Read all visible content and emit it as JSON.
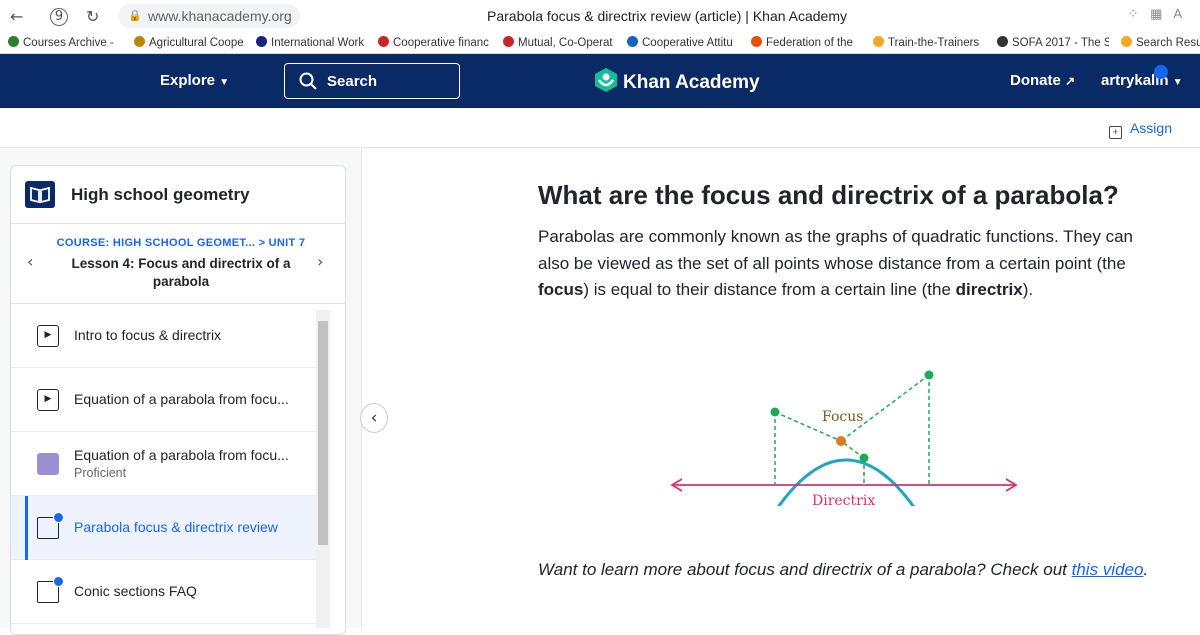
{
  "browser": {
    "url": "www.khanacademy.org",
    "tab_title": "Parabola focus & directrix review (article) | Khan Academy",
    "bookmarks": [
      {
        "label": "Courses Archive - ",
        "color": "#2e7d32"
      },
      {
        "label": "Agricultural Coope",
        "color": "#b8860b"
      },
      {
        "label": "International Work",
        "color": "#1a237e"
      },
      {
        "label": "Cooperative financ",
        "color": "#c62828"
      },
      {
        "label": "Mutual, Co-Operat",
        "color": "#c62828"
      },
      {
        "label": "Cooperative Attitu",
        "color": "#1565c0"
      },
      {
        "label": "Federation of the",
        "color": "#e65100"
      },
      {
        "label": "Train-the-Trainers",
        "color": "#f9a825"
      },
      {
        "label": "SOFA 2017 - The S",
        "color": "#333333"
      },
      {
        "label": "Search Resu",
        "color": "#f9a825"
      }
    ]
  },
  "nav": {
    "explore": "Explore",
    "search": "Search",
    "logo": "Khan Academy",
    "donate": "Donate",
    "user": "artrykalin"
  },
  "assign": "Assign",
  "sidebar": {
    "course": "High school geometry",
    "breadcrumb": "COURSE: HIGH SCHOOL GEOMET... > UNIT 7",
    "lesson": "Lesson 4: Focus and directrix of a parabola",
    "items": [
      {
        "label": "Intro to focus & directrix",
        "sub": ""
      },
      {
        "label": "Equation of a parabola from focu...",
        "sub": ""
      },
      {
        "label": "Equation of a parabola from focu...",
        "sub": "Proficient"
      },
      {
        "label": "Parabola focus & directrix review",
        "sub": ""
      },
      {
        "label": "Conic sections FAQ",
        "sub": ""
      }
    ]
  },
  "article": {
    "title": "What are the focus and directrix of a parabola?",
    "p1_a": "Parabolas are commonly known as the graphs of quadratic functions. They can also be viewed as the set of all points whose distance from a certain point (the ",
    "p1_focus": "focus",
    "p1_b": ") is equal to their distance from a certain line (the ",
    "p1_directrix": "directrix",
    "p1_c": ").",
    "learn_text": "Want to learn more about focus and directrix of a parabola? Check out ",
    "learn_link": "this video",
    "learn_end": ".",
    "diagram": {
      "focus_label": "Focus",
      "directrix_label": "Directrix",
      "curve_color": "#21a3c5",
      "line_color": "#d6336c",
      "focus_color": "#e07c1d",
      "point_color": "#1fab54"
    }
  }
}
